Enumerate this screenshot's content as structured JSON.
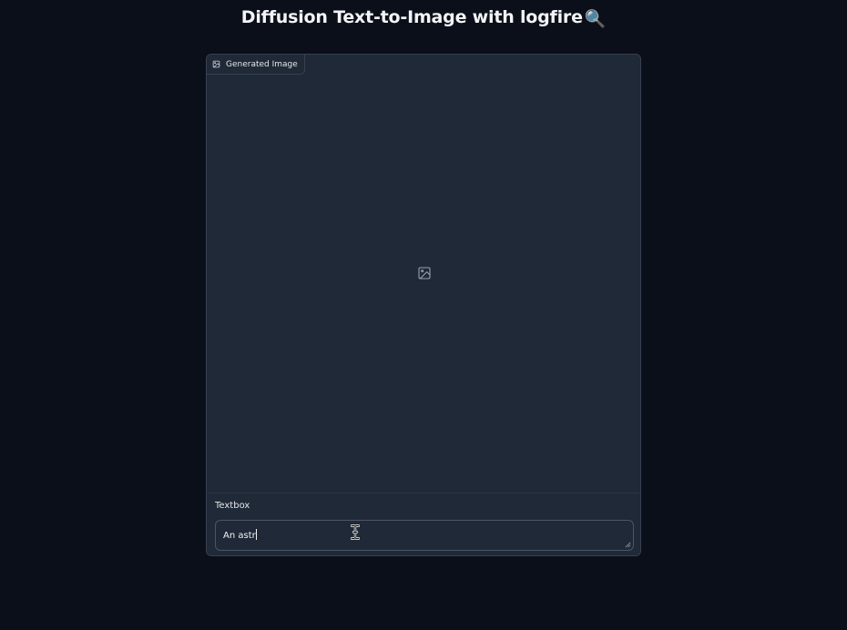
{
  "page": {
    "title": "Diffusion Text-to-Image with logfire",
    "title_emoji": "🔍"
  },
  "image_output": {
    "label": "Generated Image",
    "label_icon": "image-icon",
    "placeholder_icon": "image-icon"
  },
  "textbox": {
    "label": "Textbox",
    "value": "An astr"
  },
  "colors": {
    "background": "#0b0f19",
    "panel": "#1f2937",
    "border": "#374151",
    "text": "#e5e7eb"
  }
}
